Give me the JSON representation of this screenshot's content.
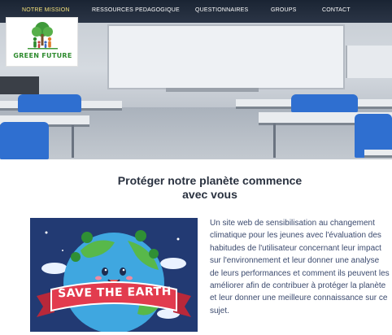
{
  "nav": {
    "items": [
      {
        "label": "NOTRE MISSION",
        "active": true
      },
      {
        "label": "RESSOURCES PEDAGOGIQUE",
        "active": false
      },
      {
        "label": "QUESTIONNAIRES",
        "active": false
      },
      {
        "label": "GROUPS",
        "active": false
      },
      {
        "label": "CONTACT",
        "active": false
      }
    ]
  },
  "logo": {
    "text": "GREEN FUTURE"
  },
  "main": {
    "headline_line1": "Protéger notre planète commence",
    "headline_line2": "avec vous",
    "illustration": {
      "banner_text": "SAVE THE EARTH"
    },
    "description": "Un site web de sensibilisation au changement climatique pour les jeunes avec l'évaluation des habitudes de l'utilisateur concernant leur impact sur l'environnement et leur donner une analyse de leurs performances et comment ils peuvent les améliorer afin de contribuer à protéger la planète et leur donner une meilleure connaissance sur ce sujet."
  },
  "colors": {
    "nav_active": "#f3e07a",
    "nav_text": "#ffffff",
    "brand_green": "#2e8b2e",
    "headline": "#2a3240",
    "body_text": "#3b4a6e",
    "illustration_bg": "#223a73"
  }
}
